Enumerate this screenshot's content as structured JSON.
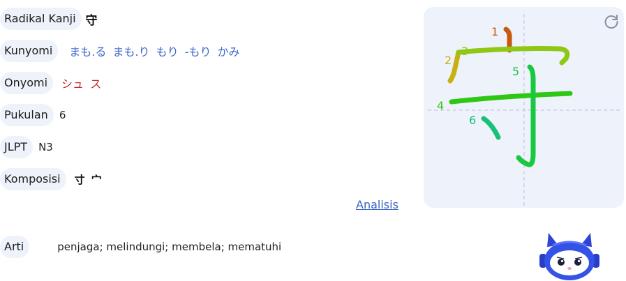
{
  "rows": {
    "radikal": {
      "label": "Radikal Kanji",
      "value": "守"
    },
    "kunyomi": {
      "label": "Kunyomi",
      "value": "まも.る まも.り もり -もり かみ"
    },
    "onyomi": {
      "label": "Onyomi",
      "value": "シュ ス"
    },
    "pukulan": {
      "label": "Pukulan",
      "value": "6"
    },
    "jlpt": {
      "label": "JLPT",
      "value": "N3"
    },
    "komposisi": {
      "label": "Komposisi",
      "value": "寸 宀"
    }
  },
  "analysis_link": "Analisis",
  "arti": {
    "label": "Arti",
    "value": "penjaga; melindungi; membela; mematuhi"
  },
  "stroke_order": {
    "numbers": [
      "1",
      "2",
      "3",
      "4",
      "5",
      "6"
    ],
    "colors": [
      "#c85a10",
      "#c8b010",
      "#8ec814",
      "#2ec814",
      "#18c840",
      "#18c078"
    ],
    "guide_color": "#b9bfda",
    "panel_color": "#eef2fb"
  },
  "icons": {
    "replay": "replay-icon",
    "mascot": "mascot-robot-icon"
  }
}
